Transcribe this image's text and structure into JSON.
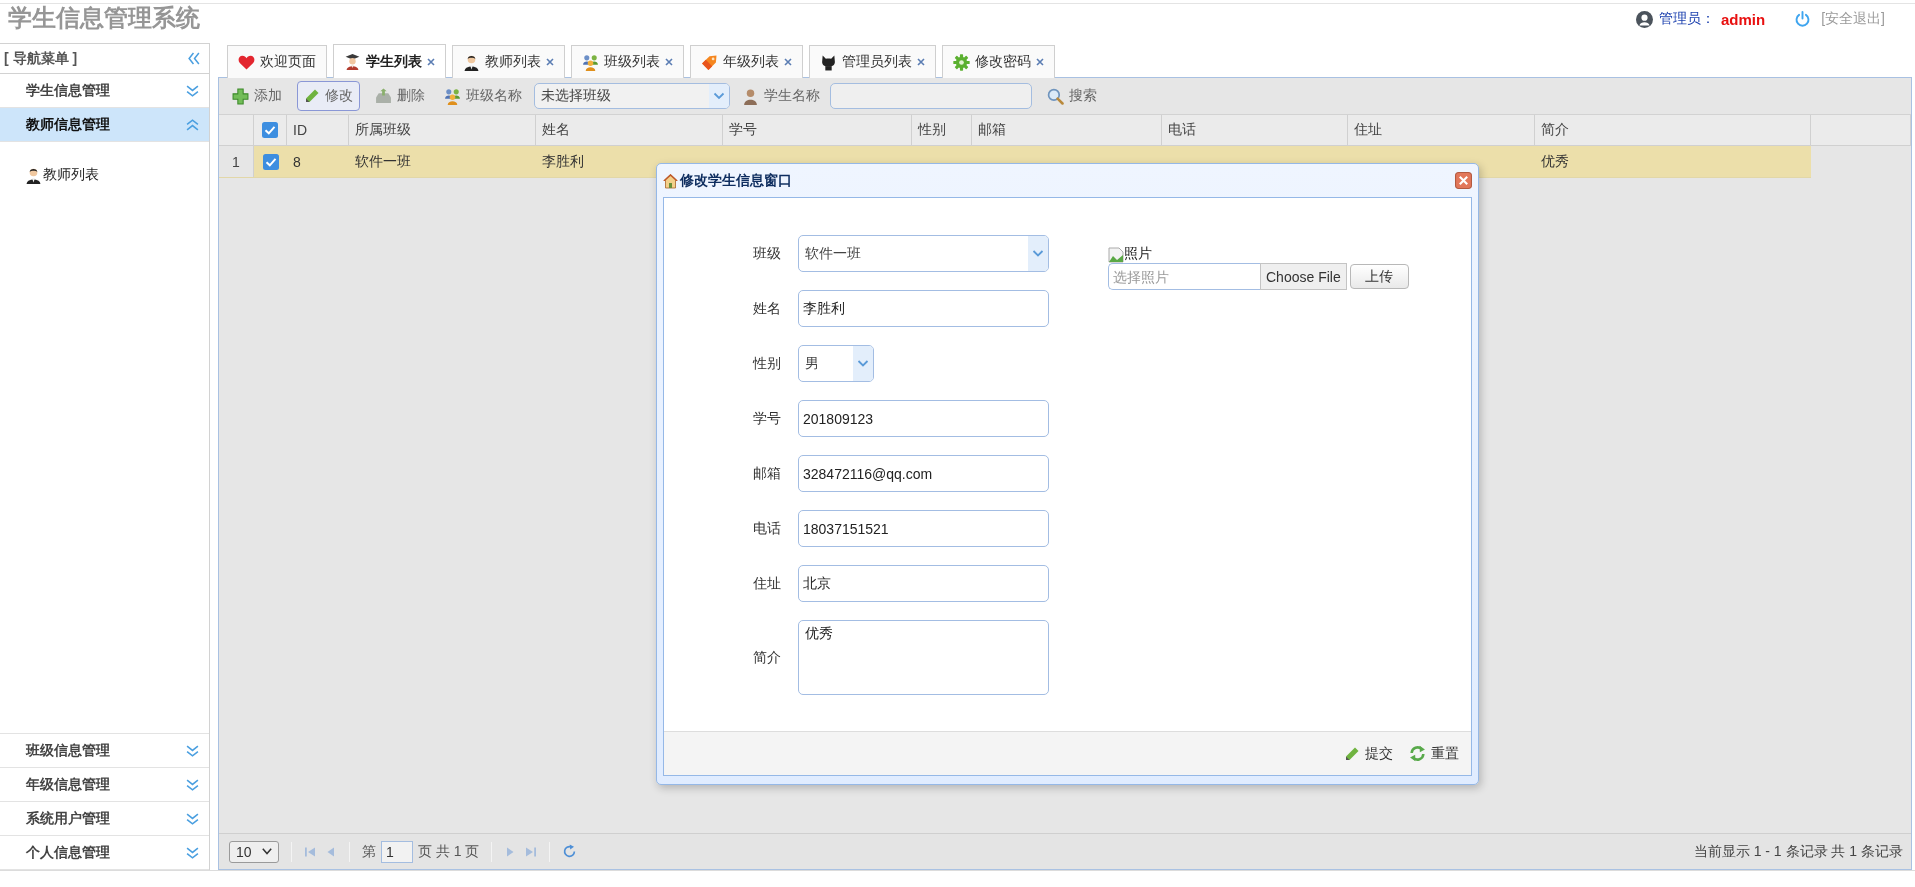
{
  "header": {
    "title": "学生信息管理系统",
    "user_label": "管理员：",
    "user_name": "admin",
    "logout": "[安全退出]"
  },
  "sidebar": {
    "title": "[ 导航菜单 ]",
    "sections": [
      {
        "label": "学生信息管理",
        "expanded": false
      },
      {
        "label": "教师信息管理",
        "expanded": true,
        "items": [
          {
            "label": "教师列表"
          }
        ]
      },
      {
        "label": "班级信息管理",
        "expanded": false
      },
      {
        "label": "年级信息管理",
        "expanded": false
      },
      {
        "label": "系统用户管理",
        "expanded": false
      },
      {
        "label": "个人信息管理",
        "expanded": false
      }
    ]
  },
  "tabs": [
    {
      "label": "欢迎页面",
      "selected": false,
      "closable": false
    },
    {
      "label": "学生列表",
      "selected": true,
      "closable": true
    },
    {
      "label": "教师列表",
      "selected": false,
      "closable": true
    },
    {
      "label": "班级列表",
      "selected": false,
      "closable": true
    },
    {
      "label": "年级列表",
      "selected": false,
      "closable": true
    },
    {
      "label": "管理员列表",
      "selected": false,
      "closable": true
    },
    {
      "label": "修改密码",
      "selected": false,
      "closable": true
    }
  ],
  "toolbar": {
    "items": [
      {
        "kind": "button",
        "label": "添加",
        "active": false
      },
      {
        "kind": "button",
        "label": "修改",
        "active": true
      },
      {
        "kind": "button",
        "label": "删除",
        "active": false
      },
      {
        "kind": "label",
        "label": "班级名称"
      },
      {
        "kind": "select",
        "value": "未选择班级"
      },
      {
        "kind": "label",
        "label": "学生名称"
      },
      {
        "kind": "input"
      },
      {
        "kind": "button",
        "label": "搜索",
        "active": false
      }
    ]
  },
  "table": {
    "all_checked": true,
    "columns": [
      "ID",
      "所属班级",
      "姓名",
      "学号",
      "性别",
      "邮箱",
      "电话",
      "住址",
      "简介"
    ],
    "rows": [
      {
        "number": "1",
        "checked": true,
        "selected": true,
        "cells": [
          "8",
          "软件一班",
          "李胜利",
          null,
          null,
          null,
          null,
          null,
          "优秀"
        ]
      }
    ]
  },
  "pager": {
    "page_size": "10",
    "page_prefix": "第",
    "page": "1",
    "page_suffix": "页 共 1 页",
    "summary": "当前显示 1 - 1 条记录 共 1 条记录"
  },
  "dialog": {
    "title": "修改学生信息窗口",
    "fields": [
      {
        "kind": "select",
        "label": "班级",
        "value": "软件一班"
      },
      {
        "kind": "text",
        "label": "姓名",
        "value": "李胜利"
      },
      {
        "kind": "select",
        "label": "性别",
        "value": "男"
      },
      {
        "kind": "text",
        "label": "学号",
        "value": "201809123"
      },
      {
        "kind": "text",
        "label": "邮箱",
        "value": "328472116@qq.com"
      },
      {
        "kind": "text",
        "label": "电话",
        "value": "18037151521"
      },
      {
        "kind": "text",
        "label": "住址",
        "value": "北京"
      },
      {
        "kind": "textarea",
        "label": "简介",
        "value": "优秀"
      }
    ],
    "photo": {
      "alt": "照片",
      "placeholder": "选择照片",
      "file_button": "Choose File",
      "upload_button": "上传"
    },
    "buttons": [
      {
        "label": "提交"
      },
      {
        "label": "重置"
      }
    ]
  }
}
